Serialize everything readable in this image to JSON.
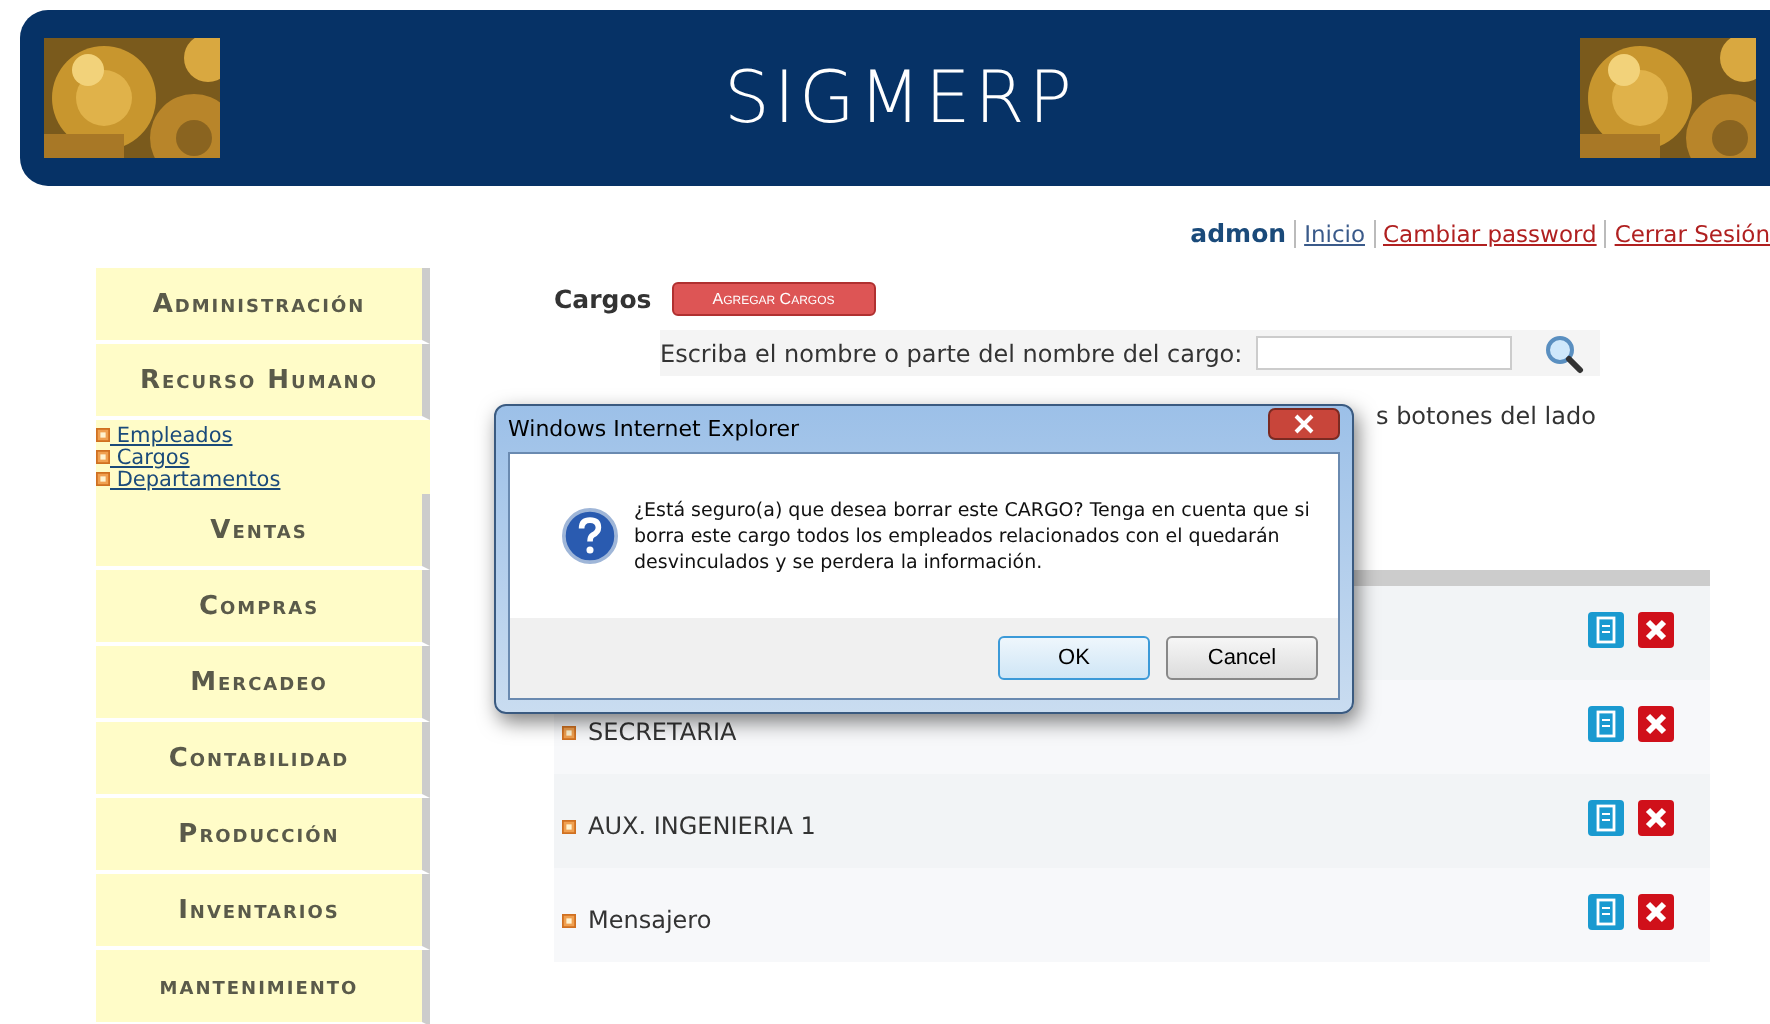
{
  "header": {
    "title": "SIGMERP"
  },
  "user_bar": {
    "user": "admon",
    "links": [
      "Inicio",
      "Cambiar password",
      "Cerrar Sesión"
    ]
  },
  "sidebar": [
    {
      "label": "Administración"
    },
    {
      "label": "Recurso Humano",
      "children": [
        {
          "label": " Empleados"
        },
        {
          "label": " Cargos"
        },
        {
          "label": " Departamentos"
        }
      ]
    },
    {
      "label": "Ventas"
    },
    {
      "label": "Compras"
    },
    {
      "label": "Mercadeo"
    },
    {
      "label": "Contabilidad"
    },
    {
      "label": "Producción"
    },
    {
      "label": "Inventarios"
    },
    {
      "label": "mantenimiento"
    }
  ],
  "page": {
    "title": "Cargos",
    "add_button": "Agregar Cargos",
    "search_label": "Escriba el nombre o parte del nombre del cargo:",
    "hint": "s botones del lado"
  },
  "rows": [
    {},
    {
      "name": "SECRETARIA"
    },
    {
      "name": "AUX. INGENIERIA 1"
    },
    {
      "name": "Mensajero"
    }
  ],
  "dialog": {
    "title": "Windows Internet Explorer",
    "message": "¿Está seguro(a) que desea borrar este CARGO? Tenga en cuenta que si borra este cargo todos los empleados relacionados con el quedarán desvinculados y se perdera la información.",
    "buttons": [
      {
        "label": "OK",
        "selected": true
      },
      {
        "label": "Cancel",
        "selected": false
      }
    ]
  }
}
